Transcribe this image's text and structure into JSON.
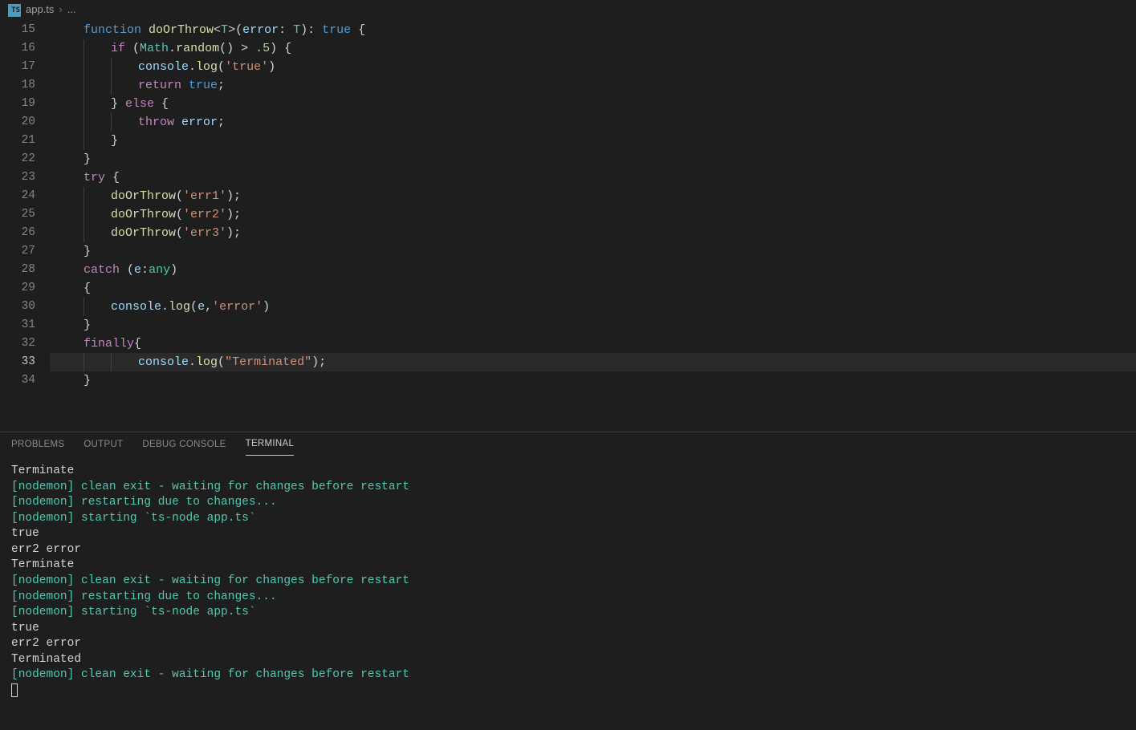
{
  "breadcrumbs": {
    "file_icon_text": "TS",
    "file_name": "app.ts",
    "separator": "›",
    "trail": "..."
  },
  "editor": {
    "current_line": 33,
    "lines": [
      {
        "num": 15,
        "indent": 1,
        "tokens": [
          [
            "t-blue",
            "function "
          ],
          [
            "t-fn",
            "doOrThrow"
          ],
          [
            "t-pn",
            "<"
          ],
          [
            "t-type",
            "T"
          ],
          [
            "t-pn",
            ">("
          ],
          [
            "t-var",
            "error"
          ],
          [
            "t-pn",
            ": "
          ],
          [
            "t-type",
            "T"
          ],
          [
            "t-pn",
            "): "
          ],
          [
            "t-blue",
            "true"
          ],
          [
            "t-pn",
            " {"
          ]
        ]
      },
      {
        "num": 16,
        "indent": 2,
        "tokens": [
          [
            "t-pink",
            "if"
          ],
          [
            "t-pn",
            " ("
          ],
          [
            "t-type",
            "Math"
          ],
          [
            "t-pn",
            "."
          ],
          [
            "t-fn",
            "random"
          ],
          [
            "t-pn",
            "() > "
          ],
          [
            "t-num",
            ".5"
          ],
          [
            "t-pn",
            ") {"
          ]
        ]
      },
      {
        "num": 17,
        "indent": 3,
        "tokens": [
          [
            "t-var",
            "console"
          ],
          [
            "t-pn",
            "."
          ],
          [
            "t-fn",
            "log"
          ],
          [
            "t-pn",
            "("
          ],
          [
            "t-str",
            "'true'"
          ],
          [
            "t-pn",
            ")"
          ]
        ]
      },
      {
        "num": 18,
        "indent": 3,
        "tokens": [
          [
            "t-pink",
            "return "
          ],
          [
            "t-blue",
            "true"
          ],
          [
            "t-pn",
            ";"
          ]
        ]
      },
      {
        "num": 19,
        "indent": 2,
        "tokens": [
          [
            "t-pn",
            "} "
          ],
          [
            "t-pink",
            "else"
          ],
          [
            "t-pn",
            " {"
          ]
        ]
      },
      {
        "num": 20,
        "indent": 3,
        "tokens": [
          [
            "t-pink",
            "throw "
          ],
          [
            "t-var",
            "error"
          ],
          [
            "t-pn",
            ";"
          ]
        ]
      },
      {
        "num": 21,
        "indent": 2,
        "tokens": [
          [
            "t-pn",
            "}"
          ]
        ]
      },
      {
        "num": 22,
        "indent": 1,
        "tokens": [
          [
            "t-pn",
            "}"
          ]
        ]
      },
      {
        "num": 23,
        "indent": 1,
        "tokens": [
          [
            "t-pink",
            "try"
          ],
          [
            "t-pn",
            " {"
          ]
        ]
      },
      {
        "num": 24,
        "indent": 2,
        "tokens": [
          [
            "t-fn",
            "doOrThrow"
          ],
          [
            "t-pn",
            "("
          ],
          [
            "t-str",
            "'err1'"
          ],
          [
            "t-pn",
            ");"
          ]
        ]
      },
      {
        "num": 25,
        "indent": 2,
        "tokens": [
          [
            "t-fn",
            "doOrThrow"
          ],
          [
            "t-pn",
            "("
          ],
          [
            "t-str",
            "'err2'"
          ],
          [
            "t-pn",
            ");"
          ]
        ]
      },
      {
        "num": 26,
        "indent": 2,
        "tokens": [
          [
            "t-fn",
            "doOrThrow"
          ],
          [
            "t-pn",
            "("
          ],
          [
            "t-str",
            "'err3'"
          ],
          [
            "t-pn",
            ");"
          ]
        ]
      },
      {
        "num": 27,
        "indent": 1,
        "tokens": [
          [
            "t-pn",
            "}"
          ]
        ]
      },
      {
        "num": 28,
        "indent": 1,
        "tokens": [
          [
            "t-pink",
            "catch"
          ],
          [
            "t-pn",
            " ("
          ],
          [
            "t-var",
            "e"
          ],
          [
            "t-pn",
            ":"
          ],
          [
            "t-type",
            "any"
          ],
          [
            "t-pn",
            ")"
          ]
        ]
      },
      {
        "num": 29,
        "indent": 1,
        "tokens": [
          [
            "t-pn",
            "{"
          ]
        ]
      },
      {
        "num": 30,
        "indent": 2,
        "tokens": [
          [
            "t-var",
            "console"
          ],
          [
            "t-pn",
            "."
          ],
          [
            "t-fn",
            "log"
          ],
          [
            "t-pn",
            "("
          ],
          [
            "t-var",
            "e"
          ],
          [
            "t-pn",
            ","
          ],
          [
            "t-str",
            "'error'"
          ],
          [
            "t-pn",
            ")"
          ]
        ]
      },
      {
        "num": 31,
        "indent": 1,
        "tokens": [
          [
            "t-pn",
            "}"
          ]
        ]
      },
      {
        "num": 32,
        "indent": 1,
        "tokens": [
          [
            "t-pink",
            "finally"
          ],
          [
            "t-pn",
            "{"
          ]
        ]
      },
      {
        "num": 33,
        "indent": 3,
        "tokens": [
          [
            "t-var",
            "console"
          ],
          [
            "t-pn",
            "."
          ],
          [
            "t-fn",
            "log"
          ],
          [
            "t-pn",
            "("
          ],
          [
            "t-str",
            "\"Terminated\""
          ],
          [
            "t-pn",
            ");"
          ]
        ]
      },
      {
        "num": 34,
        "indent": 1,
        "tokens": [
          [
            "t-pn",
            "}"
          ]
        ]
      }
    ]
  },
  "panel": {
    "tabs": [
      {
        "id": "problems",
        "label": "PROBLEMS",
        "active": false
      },
      {
        "id": "output",
        "label": "OUTPUT",
        "active": false
      },
      {
        "id": "debug",
        "label": "DEBUG CONSOLE",
        "active": false
      },
      {
        "id": "terminal",
        "label": "TERMINAL",
        "active": true
      }
    ],
    "terminal_lines": [
      {
        "text": "Terminate",
        "color": "white"
      },
      {
        "text": "[nodemon] clean exit - waiting for changes before restart",
        "color": "green"
      },
      {
        "text": "[nodemon] restarting due to changes...",
        "color": "green"
      },
      {
        "text": "[nodemon] starting `ts-node app.ts`",
        "color": "green"
      },
      {
        "text": "true",
        "color": "white"
      },
      {
        "text": "err2 error",
        "color": "white"
      },
      {
        "text": "Terminate",
        "color": "white"
      },
      {
        "text": "[nodemon] clean exit - waiting for changes before restart",
        "color": "green"
      },
      {
        "text": "[nodemon] restarting due to changes...",
        "color": "green"
      },
      {
        "text": "[nodemon] starting `ts-node app.ts`",
        "color": "green"
      },
      {
        "text": "true",
        "color": "white"
      },
      {
        "text": "err2 error",
        "color": "white"
      },
      {
        "text": "Terminated",
        "color": "white"
      },
      {
        "text": "[nodemon] clean exit - waiting for changes before restart",
        "color": "green"
      }
    ]
  }
}
